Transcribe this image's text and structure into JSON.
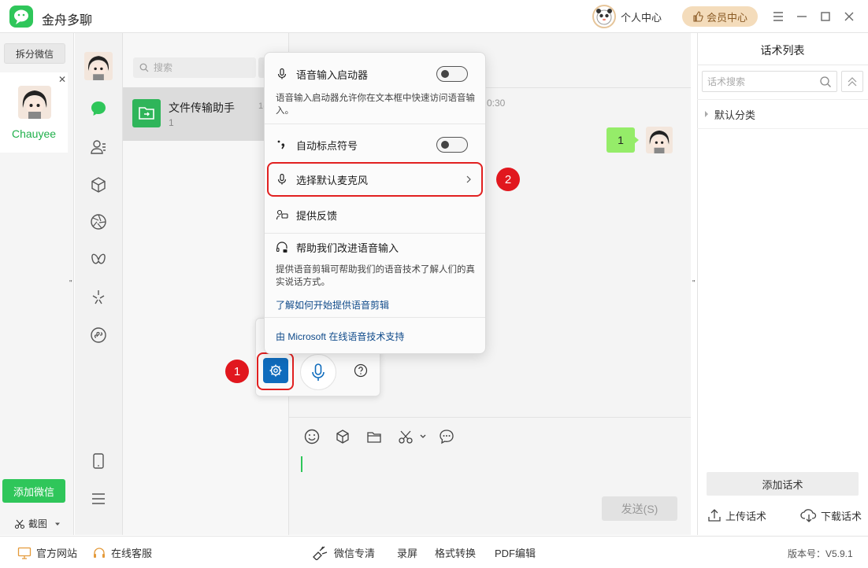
{
  "app": {
    "title": "金舟多聊"
  },
  "header": {
    "personal_center": "个人中心",
    "vip_center": "会员中心"
  },
  "accounts": {
    "split_label": "拆分微信",
    "active_name": "Chauyee",
    "add_label": "添加微信",
    "screenshot_label": "截图"
  },
  "chat_list": {
    "search_placeholder": "搜索",
    "items": [
      {
        "name": "文件传输助手",
        "count": "1",
        "date_partial": "1("
      }
    ]
  },
  "chat": {
    "time_partial": "0:30",
    "message": "1",
    "send_label": "发送(S)"
  },
  "voice_menu": {
    "launcher_label": "语音输入启动器",
    "launcher_desc": "语音输入启动器允许你在文本框中快速访问语音输入。",
    "auto_punct_label": "自动标点符号",
    "select_mic_label": "选择默认麦克风",
    "feedback_label": "提供反馈",
    "improve_label": "帮助我们改进语音输入",
    "improve_desc": "提供语音剪辑可帮助我们的语音技术了解人们的真实说话方式。",
    "learn_link": "了解如何开始提供语音剪辑",
    "powered_by": "由 Microsoft 在线语音技术支持"
  },
  "annotations": {
    "badge_1": "1",
    "badge_2": "2"
  },
  "right_panel": {
    "title": "话术列表",
    "search_placeholder": "话术搜索",
    "default_category": "默认分类",
    "add_label": "添加话术",
    "upload_label": "上传话术",
    "download_label": "下载话术"
  },
  "bottom_bar": {
    "official_site": "官方网站",
    "online_service": "在线客服",
    "wechat_clean": "微信专清",
    "record_screen": "录屏",
    "format_convert": "格式转换",
    "pdf_edit": "PDF编辑",
    "version": "版本号：V5.9.1"
  },
  "colors": {
    "brand_green": "#2fc65a",
    "highlight_red": "#e12020",
    "windows_blue": "#0f6cbd"
  }
}
